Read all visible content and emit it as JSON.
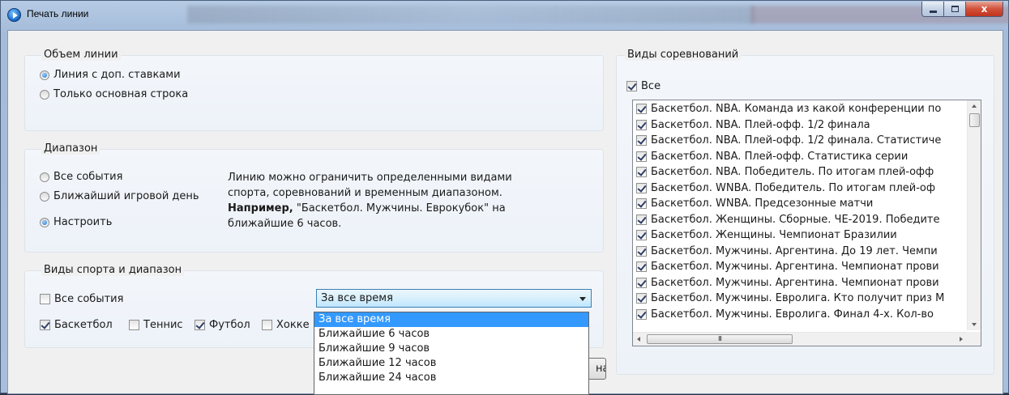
{
  "window": {
    "title": "Печать линии",
    "controls": {
      "minimize": "",
      "maximize": "",
      "close": "x"
    }
  },
  "volume_group": {
    "label": "Объем линии",
    "options": [
      {
        "label": "Линия с доп. ставками",
        "checked": true
      },
      {
        "label": "Только основная строка",
        "checked": false
      }
    ]
  },
  "range_group": {
    "label": "Диапазон",
    "options": [
      {
        "label": "Все события",
        "checked": false
      },
      {
        "label": "Ближайший игровой день",
        "checked": false
      },
      {
        "label": "Настроить",
        "checked": true
      }
    ],
    "help_line1": "Линию можно ограничить определенными видами",
    "help_line2": "спорта, соревнований и временным диапазоном.",
    "help_bold": "Например,",
    "help_line3_rest": " \"Баскетбол. Мужчины. Еврокубок\" на",
    "help_line4": "ближайшие 6 часов."
  },
  "sports_group": {
    "label": "Виды спорта и диапазон",
    "all_events": {
      "label": "Все события",
      "checked": false
    },
    "sports": [
      {
        "label": "Баскетбол",
        "checked": true
      },
      {
        "label": "Теннис",
        "checked": false
      },
      {
        "label": "Футбол",
        "checked": true
      },
      {
        "label": "Хокке",
        "checked": false
      }
    ],
    "time_combo": {
      "selected": "За все время",
      "options": [
        "За все время",
        "Ближайшие 6 часов",
        "Ближайшие 9 часов",
        "Ближайшие 12 часов",
        "Ближайшие 24 часов"
      ]
    }
  },
  "partial_button": {
    "label": "на"
  },
  "competitions_group": {
    "label": "Виды соревнований",
    "all": {
      "label": "Все",
      "checked": true
    },
    "items": [
      "Баскетбол. NBA. Команда из какой конференции по",
      "Баскетбол. NBA. Плей-офф. 1/2 финала",
      "Баскетбол. NBA. Плей-офф. 1/2 финала. Статистиче",
      "Баскетбол. NBA. Плей-офф. Статистика серии",
      "Баскетбол. NBA. Победитель. По итогам плей-офф",
      "Баскетбол. WNBA. Победитель. По итогам плей-оф",
      "Баскетбол. WNBA. Предсезонные матчи",
      "Баскетбол. Женщины. Сборные. ЧЕ-2019. Победите",
      "Баскетбол. Женщины. Чемпионат Бразилии",
      "Баскетбол. Мужчины. Аргентина. До 19 лет. Чемпи",
      "Баскетбол. Мужчины. Аргентина. Чемпионат прови",
      "Баскетбол. Мужчины. Аргентина. Чемпионат прови",
      "Баскетбол. Мужчины. Евролига. Кто получит приз М",
      "Баскетбол. Мужчины. Евролига. Финал 4-х. Кол-во"
    ],
    "hscroll_grip": "III"
  }
}
